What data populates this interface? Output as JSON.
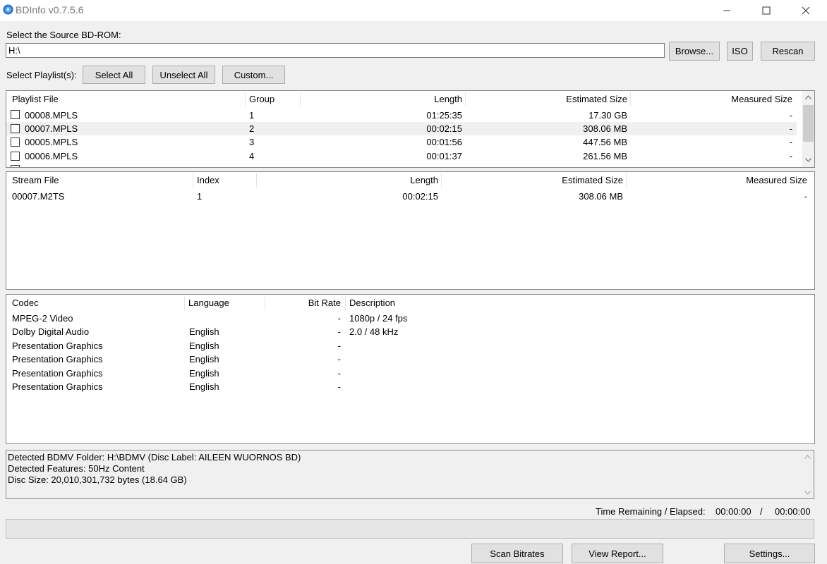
{
  "window": {
    "title": "BDInfo v0.7.5.6",
    "min_glyph": "—",
    "max_glyph": "☐",
    "close_glyph": "✕"
  },
  "source": {
    "label": "Select the Source BD-ROM:",
    "value": "H:\\",
    "browse_label": "Browse...",
    "iso_label": "ISO",
    "rescan_label": "Rescan"
  },
  "playlist_select": {
    "label": "Select Playlist(s):",
    "select_all_label": "Select All",
    "unselect_all_label": "Unselect All",
    "custom_label": "Custom..."
  },
  "playlists": {
    "columns": [
      "Playlist File",
      "Group",
      "Length",
      "Estimated Size",
      "Measured Size"
    ],
    "rows": [
      {
        "file": "00008.MPLS",
        "group": "1",
        "length": "01:25:35",
        "est": "17.30 GB",
        "measured": "-"
      },
      {
        "file": "00007.MPLS",
        "group": "2",
        "length": "00:02:15",
        "est": "308.06 MB",
        "measured": "-"
      },
      {
        "file": "00005.MPLS",
        "group": "3",
        "length": "00:01:56",
        "est": "447.56 MB",
        "measured": "-"
      },
      {
        "file": "00006.MPLS",
        "group": "4",
        "length": "00:01:37",
        "est": "261.56 MB",
        "measured": "-"
      }
    ]
  },
  "streams": {
    "columns": [
      "Stream File",
      "Index",
      "Length",
      "Estimated Size",
      "Measured Size"
    ],
    "rows": [
      {
        "file": "00007.M2TS",
        "index": "1",
        "length": "00:02:15",
        "est": "308.06 MB",
        "measured": "-"
      }
    ]
  },
  "codecs": {
    "columns": [
      "Codec",
      "Language",
      "Bit Rate",
      "Description"
    ],
    "rows": [
      {
        "codec": "MPEG-2 Video",
        "language": "",
        "bitrate": "-",
        "desc": "1080p / 24 fps"
      },
      {
        "codec": "Dolby Digital Audio",
        "language": "English",
        "bitrate": "-",
        "desc": "2.0 / 48 kHz"
      },
      {
        "codec": "Presentation Graphics",
        "language": "English",
        "bitrate": "-",
        "desc": ""
      },
      {
        "codec": "Presentation Graphics",
        "language": "English",
        "bitrate": "-",
        "desc": ""
      },
      {
        "codec": "Presentation Graphics",
        "language": "English",
        "bitrate": "-",
        "desc": ""
      },
      {
        "codec": "Presentation Graphics",
        "language": "English",
        "bitrate": "-",
        "desc": ""
      }
    ]
  },
  "info": {
    "lines": [
      "Detected BDMV Folder: H:\\BDMV (Disc Label: AILEEN WUORNOS BD)",
      "Detected Features: 50Hz Content",
      "Disc Size: 20,010,301,732 bytes (18.64 GB)"
    ]
  },
  "time": {
    "label": "Time Remaining / Elapsed:",
    "remaining": "00:00:00",
    "sep": "/",
    "elapsed": "00:00:00"
  },
  "progress": {
    "fraction": 0
  },
  "footer": {
    "scan_label": "Scan Bitrates",
    "report_label": "View Report...",
    "settings_label": "Settings..."
  },
  "colors": {
    "row_highlight": "#f0f0f0",
    "border": "#828790",
    "button": "#e1e1e1"
  }
}
